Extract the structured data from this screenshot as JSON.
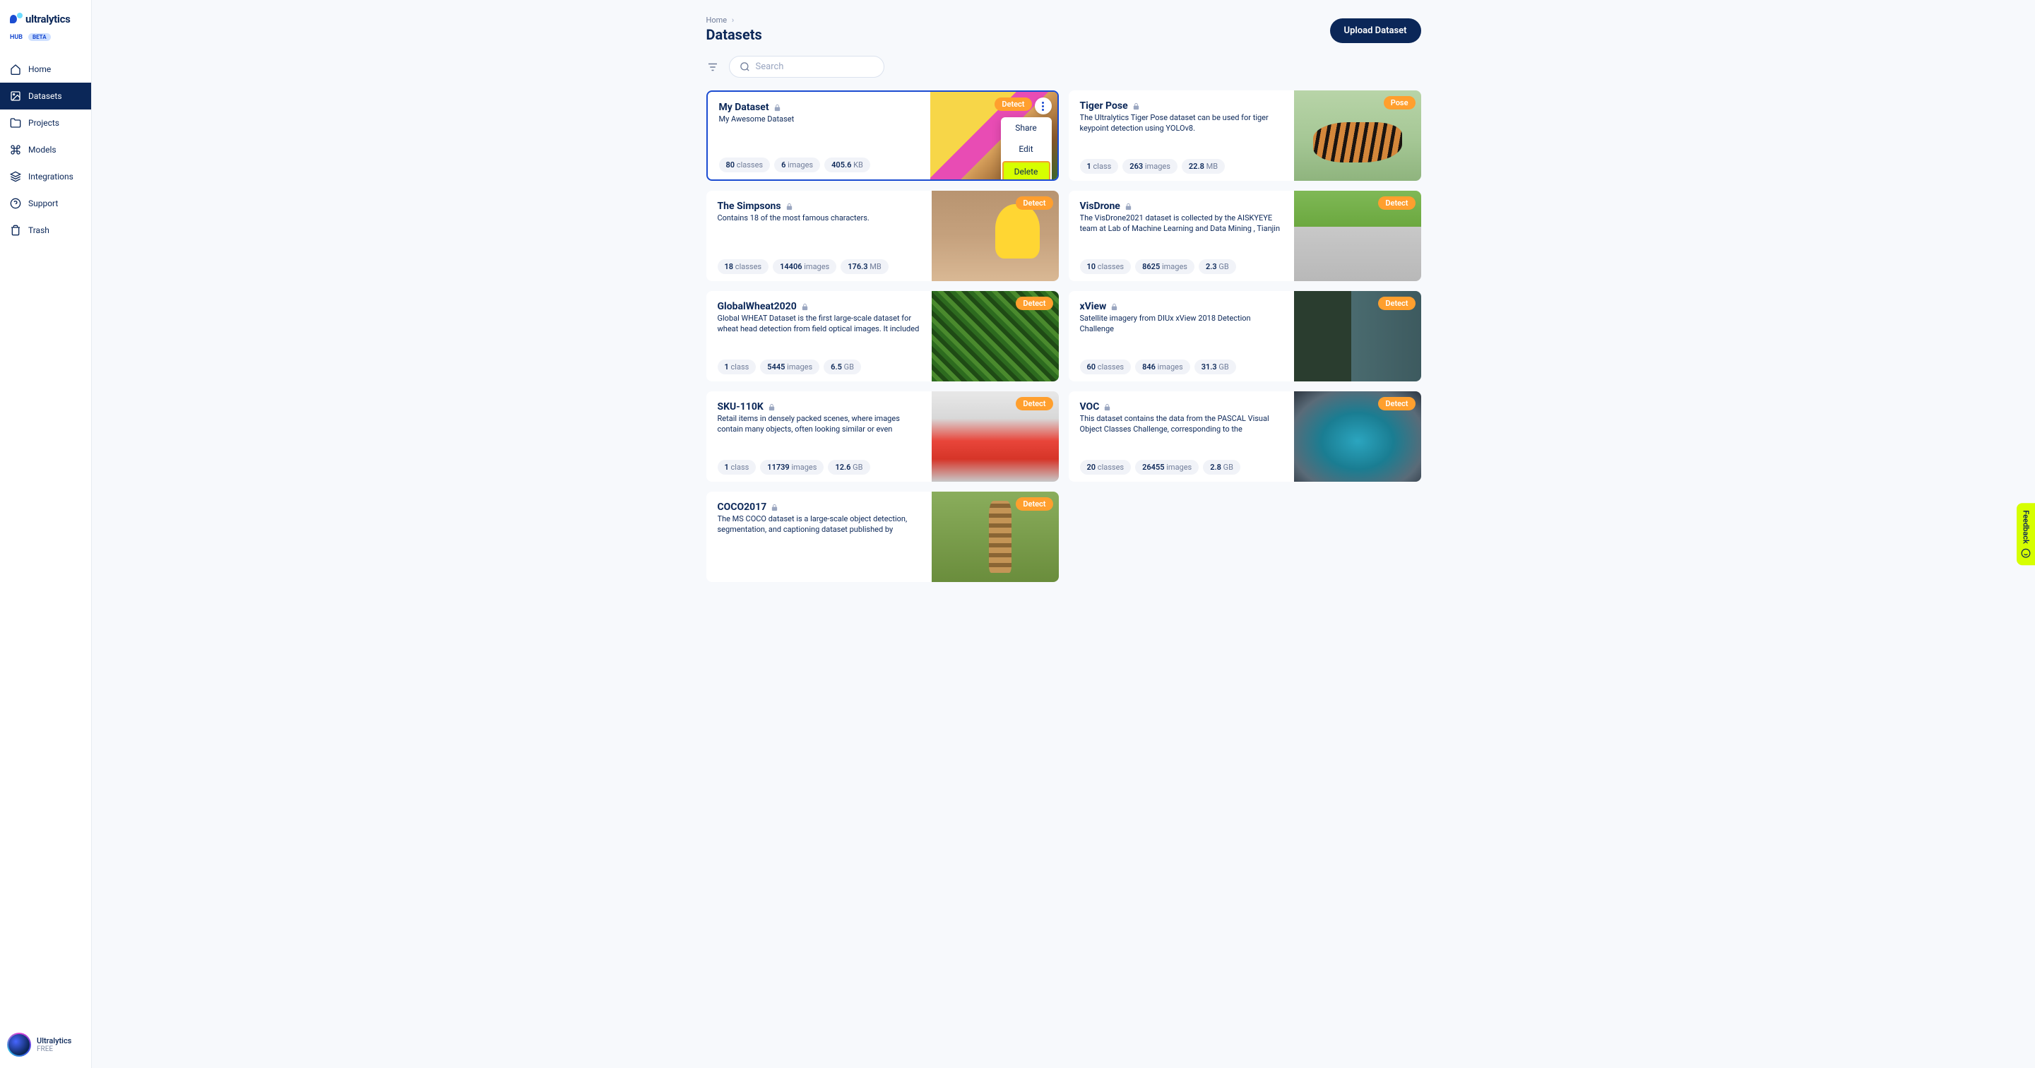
{
  "brand": {
    "name": "ultralytics",
    "sub": "HUB",
    "beta": "BETA"
  },
  "nav": {
    "home": "Home",
    "datasets": "Datasets",
    "projects": "Projects",
    "models": "Models",
    "integrations": "Integrations",
    "support": "Support",
    "trash": "Trash"
  },
  "account": {
    "name": "Ultralytics",
    "plan": "FREE"
  },
  "breadcrumb": {
    "home": "Home"
  },
  "page": {
    "title": "Datasets"
  },
  "actions": {
    "upload": "Upload Dataset"
  },
  "search": {
    "placeholder": "Search"
  },
  "menu": {
    "share": "Share",
    "edit": "Edit",
    "delete": "Delete"
  },
  "feedback": "Feedback",
  "cards": [
    {
      "title": "My Dataset",
      "desc": "My Awesome Dataset",
      "classes": "80",
      "classes_label": "classes",
      "images": "6",
      "images_label": "images",
      "size_num": "405.6",
      "size_unit": "KB",
      "badge": "Detect",
      "selected": true,
      "imgcls": "img-food",
      "menu_open": true
    },
    {
      "title": "Tiger Pose",
      "desc": "The Ultralytics Tiger Pose dataset can be used for tiger keypoint detection using YOLOv8.",
      "classes": "1",
      "classes_label": "class",
      "images": "263",
      "images_label": "images",
      "size_num": "22.8",
      "size_unit": "MB",
      "badge": "Pose",
      "imgcls": "img-tiger"
    },
    {
      "title": "The Simpsons",
      "desc": "Contains 18 of the most famous characters.",
      "classes": "18",
      "classes_label": "classes",
      "images": "14406",
      "images_label": "images",
      "size_num": "176.3",
      "size_unit": "MB",
      "badge": "Detect",
      "imgcls": "img-simpsons"
    },
    {
      "title": "VisDrone",
      "desc": "The VisDrone2021 dataset is collected by the AISKYEYE team at Lab of Machine Learning and Data Mining , Tianjin Universi...",
      "classes": "10",
      "classes_label": "classes",
      "images": "8625",
      "images_label": "images",
      "size_num": "2.3",
      "size_unit": "GB",
      "badge": "Detect",
      "imgcls": "img-visdrone"
    },
    {
      "title": "GlobalWheat2020",
      "desc": "Global WHEAT Dataset is the first large-scale dataset for wheat head detection from field optical images. It included a very lar...",
      "classes": "1",
      "classes_label": "class",
      "images": "5445",
      "images_label": "images",
      "size_num": "6.5",
      "size_unit": "GB",
      "badge": "Detect",
      "imgcls": "img-wheat"
    },
    {
      "title": "xView",
      "desc": "Satellite imagery from DIUx xView 2018 Detection Challenge",
      "classes": "60",
      "classes_label": "classes",
      "images": "846",
      "images_label": "images",
      "size_num": "31.3",
      "size_unit": "GB",
      "badge": "Detect",
      "imgcls": "img-xview"
    },
    {
      "title": "SKU-110K",
      "desc": "Retail items in densely packed scenes, where images contain many objects, often looking similar or even identical, position...",
      "classes": "1",
      "classes_label": "class",
      "images": "11739",
      "images_label": "images",
      "size_num": "12.6",
      "size_unit": "GB",
      "badge": "Detect",
      "imgcls": "img-sku"
    },
    {
      "title": "VOC",
      "desc": "This dataset contains the data from the PASCAL Visual Object Classes Challenge, corresponding to the Classification and...",
      "classes": "20",
      "classes_label": "classes",
      "images": "26455",
      "images_label": "images",
      "size_num": "2.8",
      "size_unit": "GB",
      "badge": "Detect",
      "imgcls": "img-voc"
    },
    {
      "title": "COCO2017",
      "desc": "The MS COCO dataset is a large-scale object detection, segmentation, and captioning dataset published by Microsoft.",
      "badge": "Detect",
      "imgcls": "img-coco",
      "no_stats": true
    }
  ]
}
